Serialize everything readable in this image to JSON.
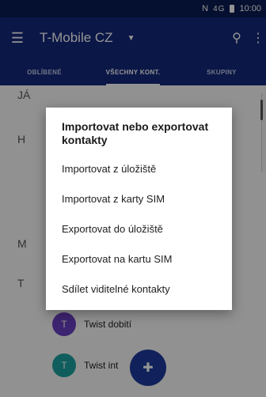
{
  "statusbar": {
    "network": "N",
    "signal": "4G",
    "time": "10:00"
  },
  "appbar": {
    "title": "T-Mobile CZ",
    "menu_icon": "hamburger-menu-icon",
    "search_icon": "search-icon",
    "more_icon": "more-vert-icon"
  },
  "tabs": [
    {
      "label": "OBLÍBENÉ"
    },
    {
      "label": "VŠECHNY KONT."
    },
    {
      "label": "SKUPINY"
    }
  ],
  "list": {
    "sections": [
      "JÁ",
      "H",
      "M",
      "T"
    ],
    "contacts": [
      {
        "name": "Twist dobití",
        "initial": "T"
      },
      {
        "name": "Twist int",
        "initial": "T"
      }
    ]
  },
  "dialog": {
    "title": "Importovat nebo exportovat kontakty",
    "options": [
      "Importovat z úložiště",
      "Importovat z karty SIM",
      "Exportovat do úložiště",
      "Exportovat na kartu SIM",
      "Sdílet viditelné kontakty"
    ]
  },
  "colors": {
    "appbar": "#13287a",
    "statusbar": "#0a1a52",
    "fab": "#1d3a9e",
    "avatar_purple": "#6a3fc2",
    "avatar_teal": "#1aa3a0"
  }
}
